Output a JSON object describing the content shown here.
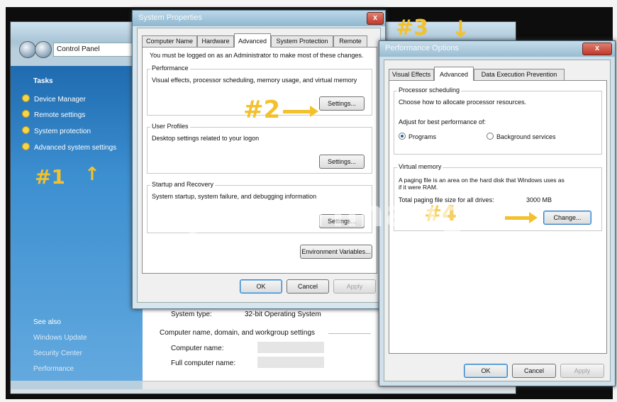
{
  "control_panel": {
    "address": "Control Panel",
    "tasks_header": "Tasks",
    "tasks": [
      "Device Manager",
      "Remote settings",
      "System protection",
      "Advanced system settings"
    ],
    "see_also_header": "See also",
    "see_also": [
      "Windows Update",
      "Security Center",
      "Performance"
    ],
    "system_type_label": "System type:",
    "system_type_value": "32-bit Operating System",
    "computer_group_title": "Computer name, domain, and workgroup settings",
    "computer_name_label": "Computer name:",
    "full_computer_name_label": "Full computer name:"
  },
  "system_properties": {
    "title": "System Properties",
    "close": "x",
    "tabs": [
      "Computer Name",
      "Hardware",
      "Advanced",
      "System Protection",
      "Remote"
    ],
    "admin_note": "You must be logged on as an Administrator to make most of these changes.",
    "performance": {
      "title": "Performance",
      "desc": "Visual effects, processor scheduling, memory usage, and virtual memory",
      "button": "Settings..."
    },
    "user_profiles": {
      "title": "User Profiles",
      "desc": "Desktop settings related to your logon",
      "button": "Settings..."
    },
    "startup": {
      "title": "Startup and Recovery",
      "desc": "System startup, system failure, and debugging information",
      "button": "Settings..."
    },
    "env_button": "Environment Variables...",
    "ok": "OK",
    "cancel": "Cancel",
    "apply": "Apply"
  },
  "performance_options": {
    "title": "Performance Options",
    "close": "x",
    "tabs": [
      "Visual Effects",
      "Advanced",
      "Data Execution Prevention"
    ],
    "processor": {
      "title": "Processor scheduling",
      "desc": "Choose how to allocate processor resources.",
      "adjust": "Adjust for best performance of:",
      "options": [
        "Programs",
        "Background services"
      ],
      "selected": "Programs"
    },
    "virtual_memory": {
      "title": "Virtual memory",
      "desc_line1": "A paging file is an area on the hard disk that Windows uses as",
      "desc_line2": "if it were RAM.",
      "total_label": "Total paging file size for all drives:",
      "total_value": "3000 MB",
      "button": "Change..."
    },
    "ok": "OK",
    "cancel": "Cancel",
    "apply": "Apply"
  },
  "annotations": {
    "step1": "#1",
    "step2": "#2",
    "step3": "#3",
    "step4": "#4"
  },
  "watermark": "uantrimang",
  "colors": {
    "annotation": "#f3c12c",
    "sidebar": "#3c8fd0"
  }
}
